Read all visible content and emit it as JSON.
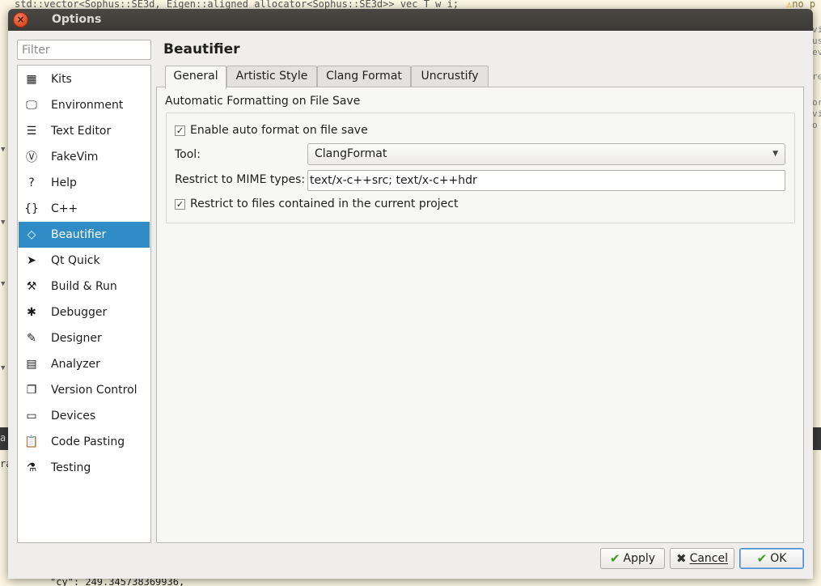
{
  "background": {
    "top_code": "std::vector<Sophus::SE3d, Eigen::aligned_allocator<Sophus::SE3d>> vec_T_w_i;",
    "top_warning": "no p",
    "bottom_code": "\"cy\": 249.345738369936,",
    "right_fragments": [
      "vi",
      "us",
      "ev",
      "re",
      "or",
      "vi",
      "o"
    ],
    "left_fragments": [
      "a",
      "ra"
    ]
  },
  "window": {
    "title": "Options",
    "close_icon": "close-icon"
  },
  "filter": {
    "placeholder": "Filter",
    "value": ""
  },
  "sidebar": {
    "items": [
      {
        "label": "Kits",
        "icon": "kits-icon",
        "glyph": "▦"
      },
      {
        "label": "Environment",
        "icon": "monitor-icon",
        "glyph": "🖵"
      },
      {
        "label": "Text Editor",
        "icon": "text-editor-icon",
        "glyph": "☰"
      },
      {
        "label": "FakeVim",
        "icon": "fakevim-icon",
        "glyph": "Ⓥ"
      },
      {
        "label": "Help",
        "icon": "help-icon",
        "glyph": "?"
      },
      {
        "label": "C++",
        "icon": "cpp-braces-icon",
        "glyph": "{}"
      },
      {
        "label": "Beautifier",
        "icon": "diamond-icon",
        "glyph": "◇"
      },
      {
        "label": "Qt Quick",
        "icon": "qt-quick-icon",
        "glyph": "➤"
      },
      {
        "label": "Build & Run",
        "icon": "hammer-icon",
        "glyph": "⚒"
      },
      {
        "label": "Debugger",
        "icon": "bug-icon",
        "glyph": "✱"
      },
      {
        "label": "Designer",
        "icon": "pen-icon",
        "glyph": "✎"
      },
      {
        "label": "Analyzer",
        "icon": "analyzer-icon",
        "glyph": "▤"
      },
      {
        "label": "Version Control",
        "icon": "version-control-icon",
        "glyph": "❐"
      },
      {
        "label": "Devices",
        "icon": "devices-icon",
        "glyph": "▭"
      },
      {
        "label": "Code Pasting",
        "icon": "clipboard-icon",
        "glyph": "📋"
      },
      {
        "label": "Testing",
        "icon": "flask-icon",
        "glyph": "⚗"
      }
    ],
    "selected": "Beautifier"
  },
  "page": {
    "title": "Beautifier"
  },
  "tabs": [
    {
      "label": "General"
    },
    {
      "label": "Artistic Style"
    },
    {
      "label": "Clang Format"
    },
    {
      "label": "Uncrustify"
    }
  ],
  "general": {
    "group_title": "Automatic Formatting on File Save",
    "enable_auto_format_label": "Enable auto format on file save",
    "enable_auto_format_checked": true,
    "tool_label": "Tool:",
    "tool_value": "ClangFormat",
    "mime_label": "Restrict to MIME types:",
    "mime_value": "text/x-c++src; text/x-c++hdr",
    "restrict_project_label": "Restrict to files contained in the current project",
    "restrict_project_checked": true
  },
  "buttons": {
    "apply": "Apply",
    "cancel": "Cancel",
    "ok": "OK"
  }
}
